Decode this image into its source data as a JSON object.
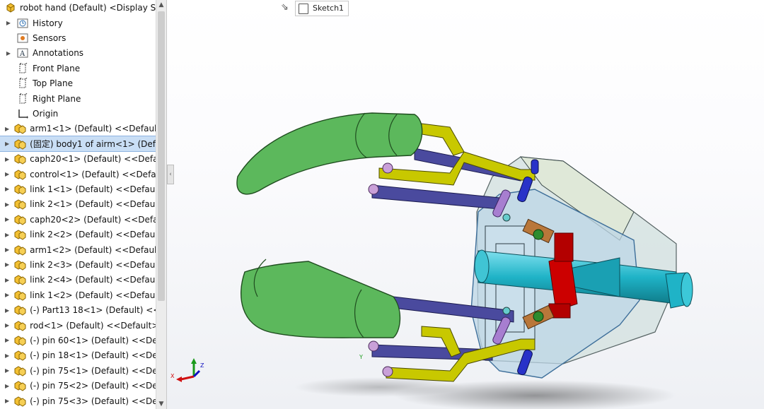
{
  "tree": {
    "root_label": "robot hand (Default) <Display Sta",
    "items": [
      {
        "label": "History",
        "icon": "history-icon",
        "caret": true
      },
      {
        "label": "Sensors",
        "icon": "sensors-icon",
        "caret": false
      },
      {
        "label": "Annotations",
        "icon": "annotations-icon",
        "caret": true
      },
      {
        "label": "Front Plane",
        "icon": "plane-icon",
        "caret": false
      },
      {
        "label": "Top Plane",
        "icon": "plane-icon",
        "caret": false
      },
      {
        "label": "Right Plane",
        "icon": "plane-icon",
        "caret": false
      },
      {
        "label": "Origin",
        "icon": "origin-icon",
        "caret": false
      },
      {
        "label": "arm1<1> (Default) <<Default:",
        "icon": "part-icon",
        "caret": true
      },
      {
        "label": "(固定) body1 of airm<1> (Def",
        "icon": "part-icon",
        "caret": true,
        "selected": true
      },
      {
        "label": "caph20<1> (Default) <<Defau",
        "icon": "part-icon",
        "caret": true
      },
      {
        "label": "control<1> (Default) <<Defau",
        "icon": "part-icon",
        "caret": true
      },
      {
        "label": "link 1<1> (Default) <<Default",
        "icon": "part-icon",
        "caret": true
      },
      {
        "label": "link 2<1> (Default) <<Default",
        "icon": "part-icon",
        "caret": true
      },
      {
        "label": "caph20<2> (Default) <<Defau",
        "icon": "part-icon",
        "caret": true
      },
      {
        "label": "link 2<2> (Default) <<Default",
        "icon": "part-icon",
        "caret": true
      },
      {
        "label": "arm1<2> (Default) <<Default:",
        "icon": "part-icon",
        "caret": true
      },
      {
        "label": "link 2<3> (Default) <<Default",
        "icon": "part-icon",
        "caret": true
      },
      {
        "label": "link 2<4> (Default) <<Default",
        "icon": "part-icon",
        "caret": true
      },
      {
        "label": "link 1<2> (Default) <<Default",
        "icon": "part-icon",
        "caret": true
      },
      {
        "label": "(-) Part13 18<1> (Default) <<I",
        "icon": "part-icon",
        "caret": true
      },
      {
        "label": "rod<1> (Default) <<Default>_",
        "icon": "part-icon",
        "caret": true
      },
      {
        "label": "(-) pin 60<1> (Default) <<Def",
        "icon": "part-icon",
        "caret": true
      },
      {
        "label": "(-) pin 18<1> (Default) <<Def",
        "icon": "part-icon",
        "caret": true
      },
      {
        "label": "(-) pin 75<1> (Default) <<Def",
        "icon": "part-icon",
        "caret": true
      },
      {
        "label": "(-) pin 75<2> (Default) <<Def",
        "icon": "part-icon",
        "caret": true
      },
      {
        "label": "(-) pin 75<3> (Default) <<Def",
        "icon": "part-icon",
        "caret": true
      }
    ]
  },
  "viewport": {
    "sketch_tab_label": "Sketch1",
    "triad": {
      "x_label": "X",
      "y_label": "Y",
      "z_label": "Z"
    }
  },
  "colors": {
    "arm_green": "#5cb85c",
    "link_yellow": "#c8c800",
    "link_blue": "#4a4a9e",
    "body_glass": "#cfe0e6",
    "rod_cyan": "#1fb3c7",
    "control_red": "#cc0000",
    "selection": "#c9def5"
  }
}
